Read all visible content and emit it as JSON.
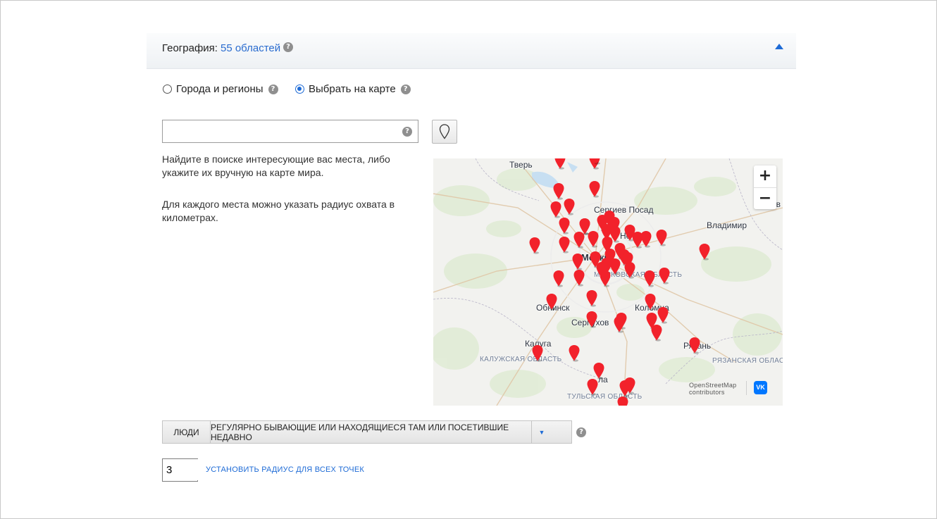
{
  "geography": {
    "label": "География:",
    "count_link": "55 областей",
    "help": "?"
  },
  "mode": {
    "option_cities": "Города и регионы",
    "option_map": "Выбрать на карте",
    "selected": "Выбрать на карте",
    "help": "?"
  },
  "search": {
    "value": "",
    "placeholder": "",
    "help": "?"
  },
  "hints": {
    "line1": "Найдите в поиске интересующие вас места, либо укажите их вручную на карте мира.",
    "line2": "Для каждого места можно указать радиус охвата в километрах."
  },
  "map": {
    "zoom_in": "+",
    "zoom_out": "−",
    "attribution_1": "OpenStreetMap",
    "attribution_2": "contributors",
    "vk_logo": "VK",
    "marker_color": "#f2222b",
    "labels": {
      "tver": "Тверь",
      "sergiev_posad": "Сергиев Посад",
      "vladimir": "Владимир",
      "moscow": "Москва",
      "noginsk": "Но",
      "moscow_region": "МОСКОВСКАЯ ОБЛАСТЬ",
      "obninsk": "Обнинск",
      "serpukhov": "Серпухов",
      "kolomna": "Коломна",
      "kaluga": "Калуга",
      "ryazan": "Рязань",
      "kaluga_region": "КАЛУЖСКАЯ ОБЛАСТЬ",
      "ryazan_region": "РЯЗАНСКАЯ ОБЛАСТЬ",
      "tula": "ла",
      "tula_region": "ТУЛЬСКАЯ ОБЛАСТЬ",
      "right_edge": "ов"
    }
  },
  "audience": {
    "people": "ЛЮДИ",
    "type": "РЕГУЛЯРНО БЫВАЮЩИЕ ИЛИ НАХОДЯЩИЕСЯ ТАМ ИЛИ ПОСЕТИВШИЕ НЕДАВНО",
    "arrow": "▼",
    "help": "?"
  },
  "radius": {
    "value": "3",
    "link": "УСТАНОВИТЬ РАДИУС ДЛЯ ВСЕХ ТОЧЕК"
  },
  "colors": {
    "accent": "#1e6bd6",
    "link": "#2a6ccf"
  }
}
